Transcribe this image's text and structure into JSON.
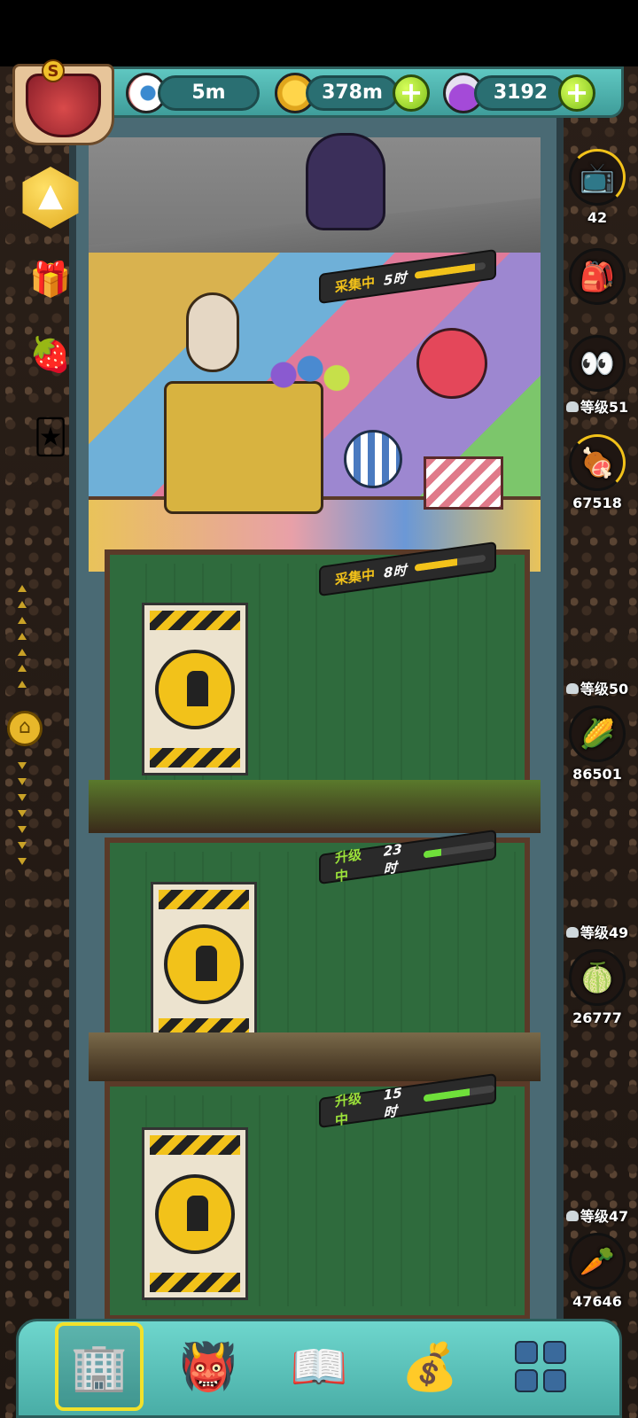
{
  "resources": {
    "eyeballs": "5m",
    "coins": "378m",
    "potions": "3192"
  },
  "rooms": [
    {
      "id": "gym",
      "status": "采集中",
      "time": "5时",
      "progress": 0.85
    },
    {
      "id": "clown",
      "status": "采集中",
      "time": "8时",
      "progress": 0.6
    },
    {
      "id": "construction-1",
      "status": "升级中",
      "time": "23时",
      "progress": 0.25
    },
    {
      "id": "construction-2",
      "status": "升级中",
      "time": "15时",
      "progress": 0.65
    }
  ],
  "side_list": [
    {
      "level": "",
      "count": "42",
      "icon": "tv-icon"
    },
    {
      "level": "",
      "count": "",
      "icon": "backpack-icon"
    },
    {
      "level": "等级51",
      "count": "",
      "icon": "eyes-icon"
    },
    {
      "level": "",
      "count": "67518",
      "icon": "meat-icon"
    },
    {
      "level": "等级50",
      "count": "86501",
      "icon": "corn-icon"
    },
    {
      "level": "等级49",
      "count": "26777",
      "icon": "melon-icon"
    },
    {
      "level": "等级47",
      "count": "47646",
      "icon": "carrot-icon"
    }
  ],
  "colors": {
    "accent": "#5fc7c1",
    "progress_collect": "#f2c21a",
    "progress_upgrade": "#6fe03a"
  }
}
